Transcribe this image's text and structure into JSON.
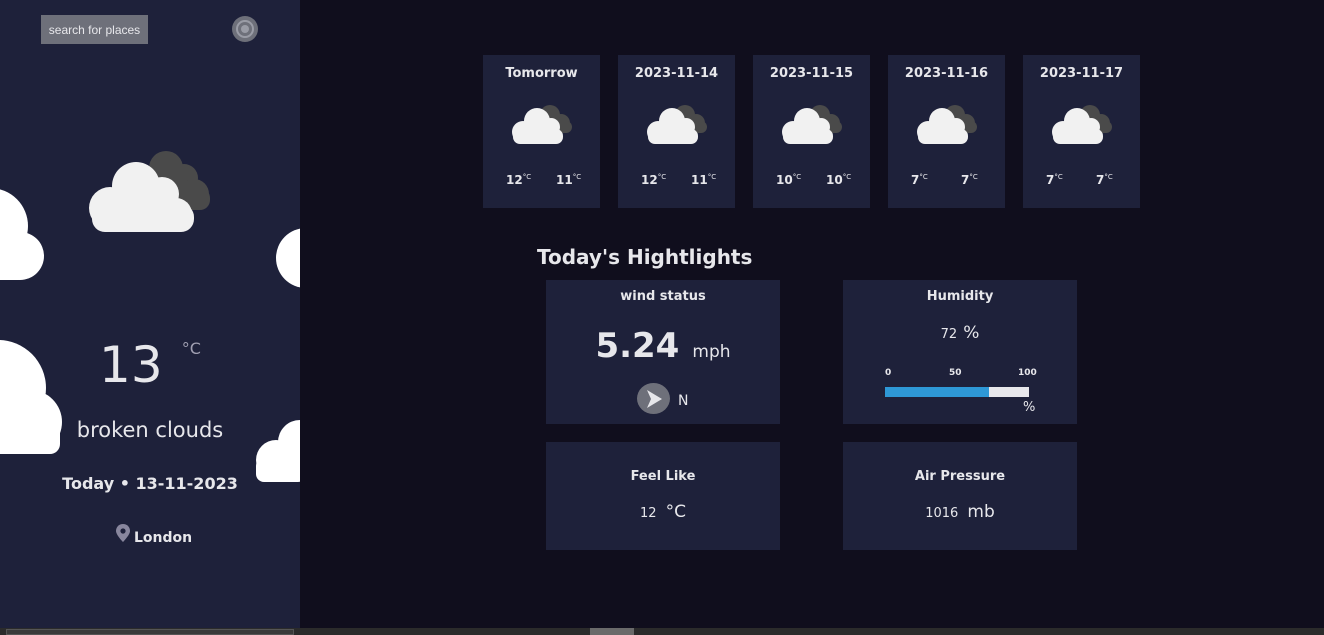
{
  "sidebar": {
    "search_label": "search for places",
    "current_icon": "broken-clouds-icon",
    "temperature": "13",
    "temperature_unit": "°C",
    "description": "broken clouds",
    "date": "Today • 13-11-2023",
    "location": "London"
  },
  "forecast": [
    {
      "day": "Tomorrow",
      "high": "12",
      "low": "11",
      "unit": "°C",
      "icon": "broken-clouds-icon"
    },
    {
      "day": "2023-11-14",
      "high": "12",
      "low": "11",
      "unit": "°C",
      "icon": "broken-clouds-icon"
    },
    {
      "day": "2023-11-15",
      "high": "10",
      "low": "10",
      "unit": "°C",
      "icon": "broken-clouds-icon"
    },
    {
      "day": "2023-11-16",
      "high": "7",
      "low": "7",
      "unit": "°C",
      "icon": "broken-clouds-icon"
    },
    {
      "day": "2023-11-17",
      "high": "7",
      "low": "7",
      "unit": "°C",
      "icon": "broken-clouds-icon"
    }
  ],
  "highlights": {
    "title": "Today's Hightlights",
    "wind": {
      "label": "wind status",
      "value": "5.24",
      "unit": "mph",
      "direction": "N"
    },
    "humidity": {
      "label": "Humidity",
      "value": "72",
      "unit": "%",
      "scale": [
        "0",
        "50",
        "100"
      ],
      "bar_unit": "%",
      "fill_percent": 72
    },
    "feel_like": {
      "label": "Feel Like",
      "value": "12",
      "unit": "°C"
    },
    "air_pressure": {
      "label": "Air Pressure",
      "value": "1016",
      "unit": "mb"
    }
  },
  "colors": {
    "background": "#100e1d",
    "card": "#1e213a",
    "accent_bar": "#2e98d6",
    "button": "#6e707a"
  }
}
